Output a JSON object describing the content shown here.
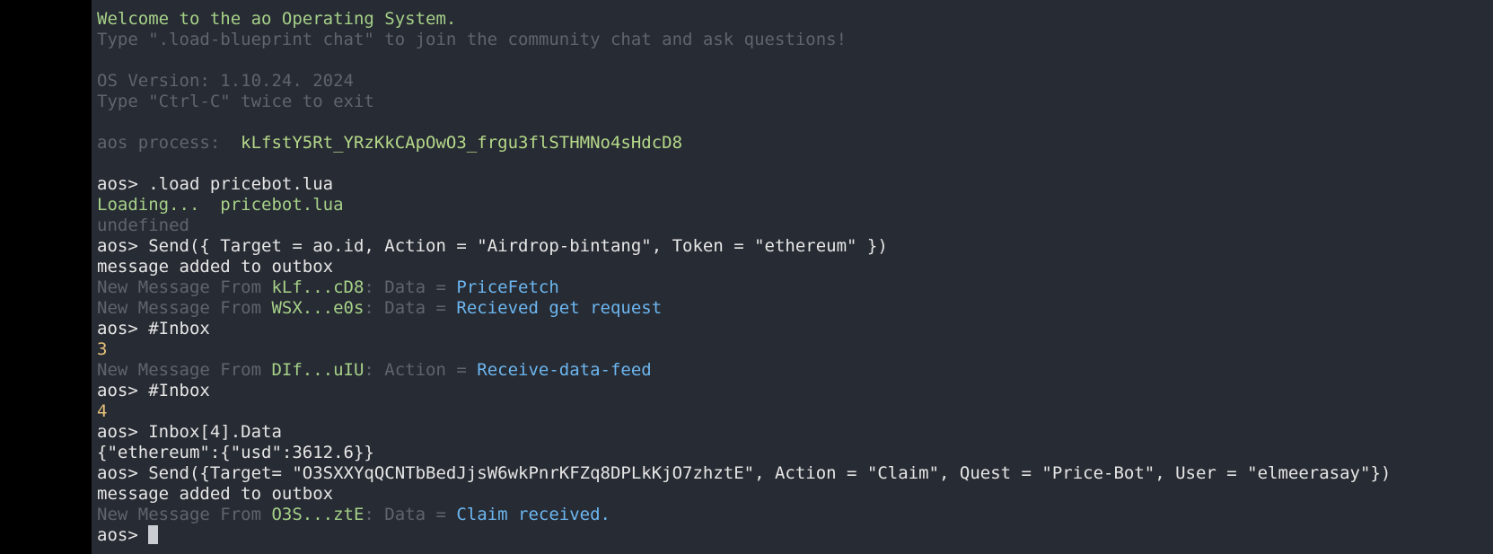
{
  "colors": {
    "background": "#272b33",
    "outer": "#000000",
    "green": "#a6d189",
    "dim": "#5f646e",
    "white": "#e6e6e6",
    "blue": "#6cb6f0",
    "yellow": "#e5c07b"
  },
  "banner": {
    "welcome": "Welcome to the ao Operating System.",
    "hint": "Type \".load-blueprint chat\" to join the community chat and ask questions!",
    "version": "OS Version: 1.10.24. 2024",
    "exit_hint": "Type \"Ctrl-C\" twice to exit",
    "process_label": "aos process:  ",
    "process_id": "kLfstY5Rt_YRzKkCApOwO3_frgu3flSTHMNo4sHdcD8"
  },
  "prompt": "aos> ",
  "session": {
    "cmd1": ".load pricebot.lua",
    "loading_label": "Loading...  ",
    "loading_file": "pricebot.lua",
    "undefined": "undefined",
    "cmd2": "Send({ Target = ao.id, Action = \"Airdrop-bintang\", Token = \"ethereum\" })",
    "outbox1": "message added to outbox",
    "msg1": {
      "prefix": "New Message From ",
      "from": "kLf...cD8",
      "sep": ": Data = ",
      "value": "PriceFetch"
    },
    "msg2": {
      "prefix": "New Message From ",
      "from": "WSX...e0s",
      "sep": ": Data = ",
      "value": "Recieved get request"
    },
    "cmd3": "#Inbox",
    "result3": "3",
    "msg3": {
      "prefix": "New Message From ",
      "from": "DIf...uIU",
      "sep": ": Action = ",
      "value": "Receive-data-feed"
    },
    "cmd4": "#Inbox",
    "result4": "4",
    "cmd5": "Inbox[4].Data",
    "result5": "{\"ethereum\":{\"usd\":3612.6}}",
    "cmd6": "Send({Target= \"O3SXXYqQCNTbBedJjsW6wkPnrKFZq8DPLkKjO7zhztE\", Action = \"Claim\", Quest = \"Price-Bot\", User = \"elmeerasay\"})",
    "outbox2": "message added to outbox",
    "msg4": {
      "prefix": "New Message From ",
      "from": "O3S...ztE",
      "sep": ": Data = ",
      "value": "Claim received."
    }
  }
}
